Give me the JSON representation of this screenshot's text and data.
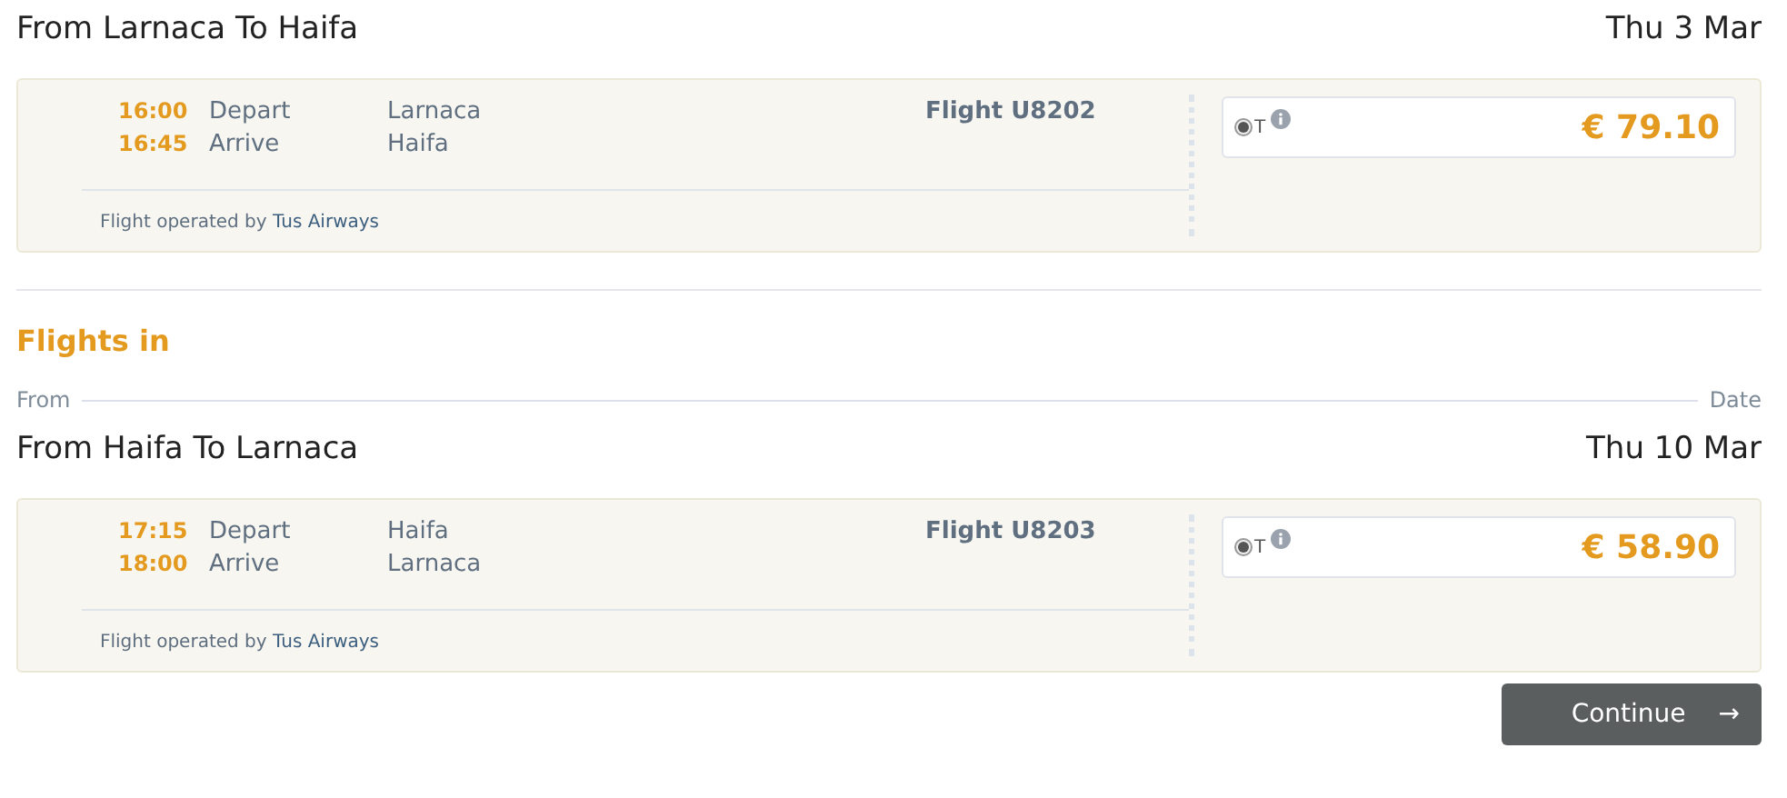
{
  "outbound": {
    "route": "From Larnaca To Haifa",
    "date": "Thu 3 Mar",
    "flight": {
      "depart_time": "16:00",
      "depart_label": "Depart",
      "depart_city": "Larnaca",
      "arrive_time": "16:45",
      "arrive_label": "Arrive",
      "arrive_city": "Haifa",
      "number": "Flight U8202",
      "operated_by": "Flight operated by",
      "airline": "Tus Airways",
      "fares": [
        {
          "class": "T",
          "price": "€ 79.10",
          "selected": true
        }
      ]
    }
  },
  "inbound_section": {
    "title": "Flights in",
    "from_label": "From",
    "date_label": "Date"
  },
  "inbound": {
    "route": "From Haifa To Larnaca",
    "date": "Thu 10 Mar",
    "flight": {
      "depart_time": "17:15",
      "depart_label": "Depart",
      "depart_city": "Haifa",
      "arrive_time": "18:00",
      "arrive_label": "Arrive",
      "arrive_city": "Larnaca",
      "number": "Flight U8203",
      "operated_by": "Flight operated by",
      "airline": "Tus Airways",
      "fares": [
        {
          "class": "T",
          "price": "€ 58.90",
          "selected": true
        }
      ]
    }
  },
  "continue_button": {
    "label": "Continue",
    "icon": "→"
  }
}
